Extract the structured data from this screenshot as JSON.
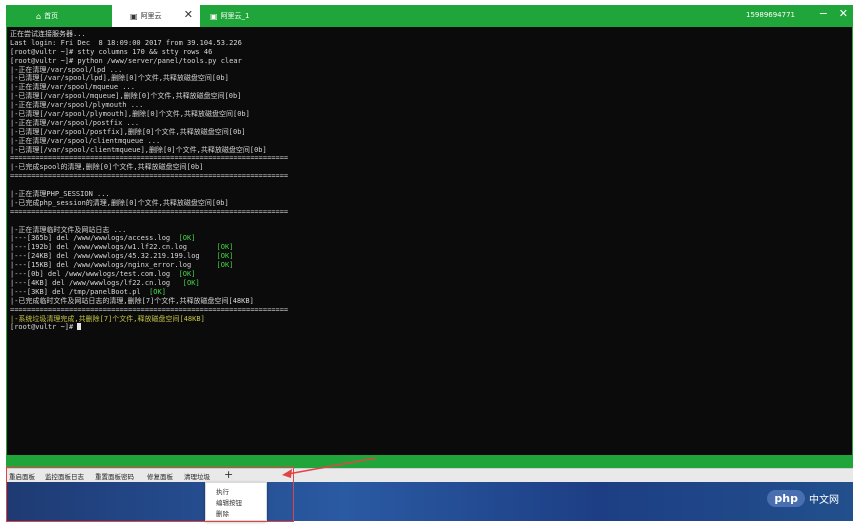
{
  "titlebar": {
    "tabs": [
      {
        "label": "首页"
      },
      {
        "label": "阿里云"
      },
      {
        "label": "阿里云_1"
      }
    ],
    "phone": "15989694771",
    "minimize": "−",
    "close": "✕",
    "tab_close": "✕"
  },
  "terminal": {
    "lines": [
      "正在尝试连接服务器...",
      "Last login: Fri Dec  8 18:09:00 2017 from 39.104.53.226",
      "[root@vultr ~]# stty columns 170 && stty rows 46",
      "[root@vultr ~]# python /www/server/panel/tools.py clear",
      "|-正在清理/var/spool/lpd ...",
      "|-已清理[/var/spool/lpd],删除[0]个文件,共释放磁盘空间[0b]",
      "|-正在清理/var/spool/mqueue ...",
      "|-已清理[/var/spool/mqueue],删除[0]个文件,共释放磁盘空间[0b]",
      "|-正在清理/var/spool/plymouth ...",
      "|-已清理[/var/spool/plymouth],删除[0]个文件,共释放磁盘空间[0b]",
      "|-正在清理/var/spool/postfix ...",
      "|-已清理[/var/spool/postfix],删除[0]个文件,共释放磁盘空间[0b]",
      "|-正在清理/var/spool/clientmqueue ...",
      "|-已清理[/var/spool/clientmqueue],删除[0]个文件,共释放磁盘空间[0b]",
      "==================================================================",
      "|-已完成spool的清理,删除[0]个文件,共释放磁盘空间[0b]",
      "==================================================================",
      "",
      "|-正在清理PHP_SESSION ...",
      "|-已完成php_session的清理,删除[0]个文件,共释放磁盘空间[0b]",
      "==================================================================",
      "",
      "|-正在清理临时文件及网站日志 ...",
      "|---[365b] del /www/wwwlogs/access.log  [OK]",
      "|---[192b] del /www/wwwlogs/w1.lf22.cn.log       [OK]",
      "|---[24KB] del /www/wwwlogs/45.32.219.199.log    [OK]",
      "|---[15KB] del /www/wwwlogs/nginx_error.log      [OK]",
      "|---[0b] del /www/wwwlogs/test.com.log  [OK]",
      "|---[4KB] del /www/wwwlogs/lf22.cn.log   [OK]",
      "|---[3KB] del /tmp/panelBoot.pl  [OK]",
      "|-已完成临时文件及网站日志的清理,删除[7]个文件,共释放磁盘空间[48KB]",
      "==================================================================",
      "|-系统垃圾清理完成,共删除[7]个文件,释放磁盘空间[48KB]",
      "[root@vultr ~]# "
    ]
  },
  "toolbar": {
    "buttons": [
      "重启面板",
      "监控面板日志",
      "重置面板密码",
      "修复面板",
      "清理垃圾"
    ],
    "add": "+"
  },
  "menu": {
    "items": [
      "执行",
      "编辑按钮",
      "删除"
    ]
  },
  "watermark": {
    "logo": "php",
    "text": "中文网"
  },
  "colors": {
    "green": "#20a53a",
    "terminal_bg": "#0b0b0b",
    "ok": "#46d94a",
    "highlight": "#c8c848",
    "annotation": "#e04545"
  }
}
